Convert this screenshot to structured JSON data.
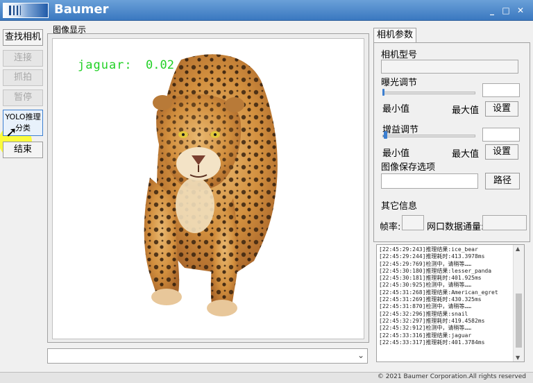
{
  "window": {
    "title": "Baumer",
    "minimize": "_",
    "maximize": "□",
    "close": "✕"
  },
  "left_buttons": {
    "find_camera": "查找相机",
    "connect": "连接",
    "capture": "抓拍",
    "pause": "暂停",
    "yolo": "YOLO推理分类",
    "end": "结束"
  },
  "image_display": {
    "label": "图像显示",
    "detection_label": "jaguar:",
    "detection_score": "0.02",
    "detection_color": "#22d126",
    "subject": "jaguar"
  },
  "camera_params": {
    "tab": "相机参数",
    "model_label": "相机型号",
    "model_value": "",
    "exposure_label": "曝光调节",
    "exposure_min": "最小值",
    "exposure_max": "最大值",
    "exposure_input": "",
    "exposure_set": "设置",
    "exposure_slider_level": 0.0,
    "gain_label": "增益调节",
    "gain_min": "最小值",
    "gain_max": "最大值",
    "gain_input": "",
    "gain_set": "设置",
    "gain_slider_level": 0.02,
    "save_label": "图像保存选项",
    "save_path_value": "",
    "path_button": "路径",
    "other_label": "其它信息",
    "fps_label": "帧率:",
    "fps_value": "",
    "throughput_label": "网口数据通量:",
    "throughput_value": ""
  },
  "log": [
    "[22:45:29:243]推理结果:ice_bear",
    "[22:45:29:244]推理耗时:413.3978ms",
    "[22:45:29:769]检测中，请稍等……",
    "[22:45:30:180]推理结果:lesser_panda",
    "[22:45:30:181]推理耗时:401.925ms",
    "[22:45:30:925]检测中，请稍等……",
    "[22:45:31:268]推理结果:American_egret",
    "[22:45:31:269]推理耗时:430.325ms",
    "[22:45:31:870]检测中，请稍等……",
    "[22:45:32:296]推理结果:snail",
    "[22:45:32:297]推理耗时:419.4582ms",
    "[22:45:32:912]检测中，请稍等……",
    "[22:45:33:316]推理结果:jaguar",
    "[22:45:33:317]推理耗时:401.3784ms"
  ],
  "statusbar": {
    "copyright": "© 2021 Baumer Corporation.All rights reserved"
  }
}
